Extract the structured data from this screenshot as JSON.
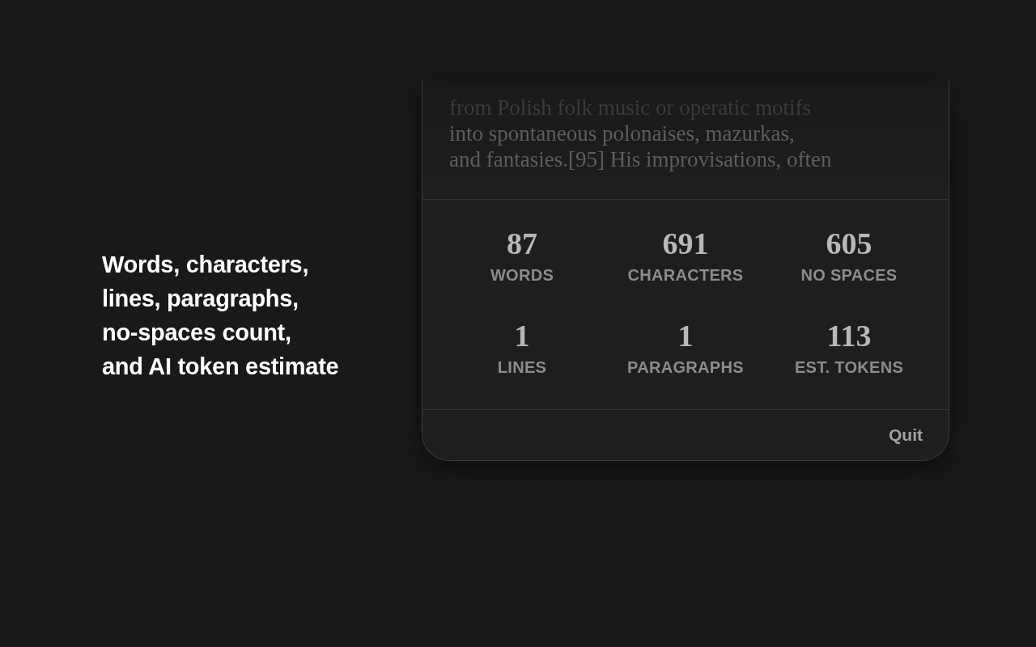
{
  "headline": [
    "Words, characters,",
    "lines, paragraphs,",
    "no-spaces count,",
    "and AI token estimate"
  ],
  "preview_lines": [
    "from Polish folk music or operatic motifs",
    "into spontaneous polonaises, mazurkas,",
    "and fantasies.[95] His improvisations, often"
  ],
  "stats": [
    {
      "value": "87",
      "label": "WORDS"
    },
    {
      "value": "691",
      "label": "CHARACTERS"
    },
    {
      "value": "605",
      "label": "NO SPACES"
    },
    {
      "value": "1",
      "label": "LINES"
    },
    {
      "value": "1",
      "label": "PARAGRAPHS"
    },
    {
      "value": "113",
      "label": "EST. TOKENS"
    }
  ],
  "footer": {
    "button": "Quit"
  }
}
